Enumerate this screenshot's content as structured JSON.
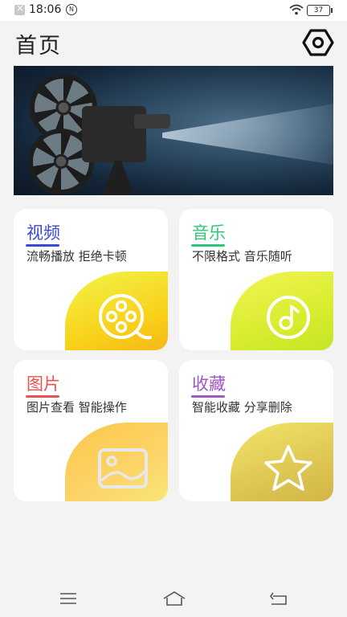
{
  "status_bar": {
    "time": "18:06",
    "nfc_label": "N",
    "battery": "37"
  },
  "header": {
    "title": "首页"
  },
  "cards": [
    {
      "title": "视频",
      "subtitle": "流畅播放 拒绝卡顿",
      "accent": "#3b49d6",
      "icon": "film-reel-icon"
    },
    {
      "title": "音乐",
      "subtitle": "不限格式 音乐随听",
      "accent": "#2fc777",
      "icon": "music-note-icon"
    },
    {
      "title": "图片",
      "subtitle": "图片查看 智能操作",
      "accent": "#e8524f",
      "icon": "image-icon"
    },
    {
      "title": "收藏",
      "subtitle": "智能收藏 分享删除",
      "accent": "#a055c9",
      "icon": "star-icon"
    }
  ]
}
